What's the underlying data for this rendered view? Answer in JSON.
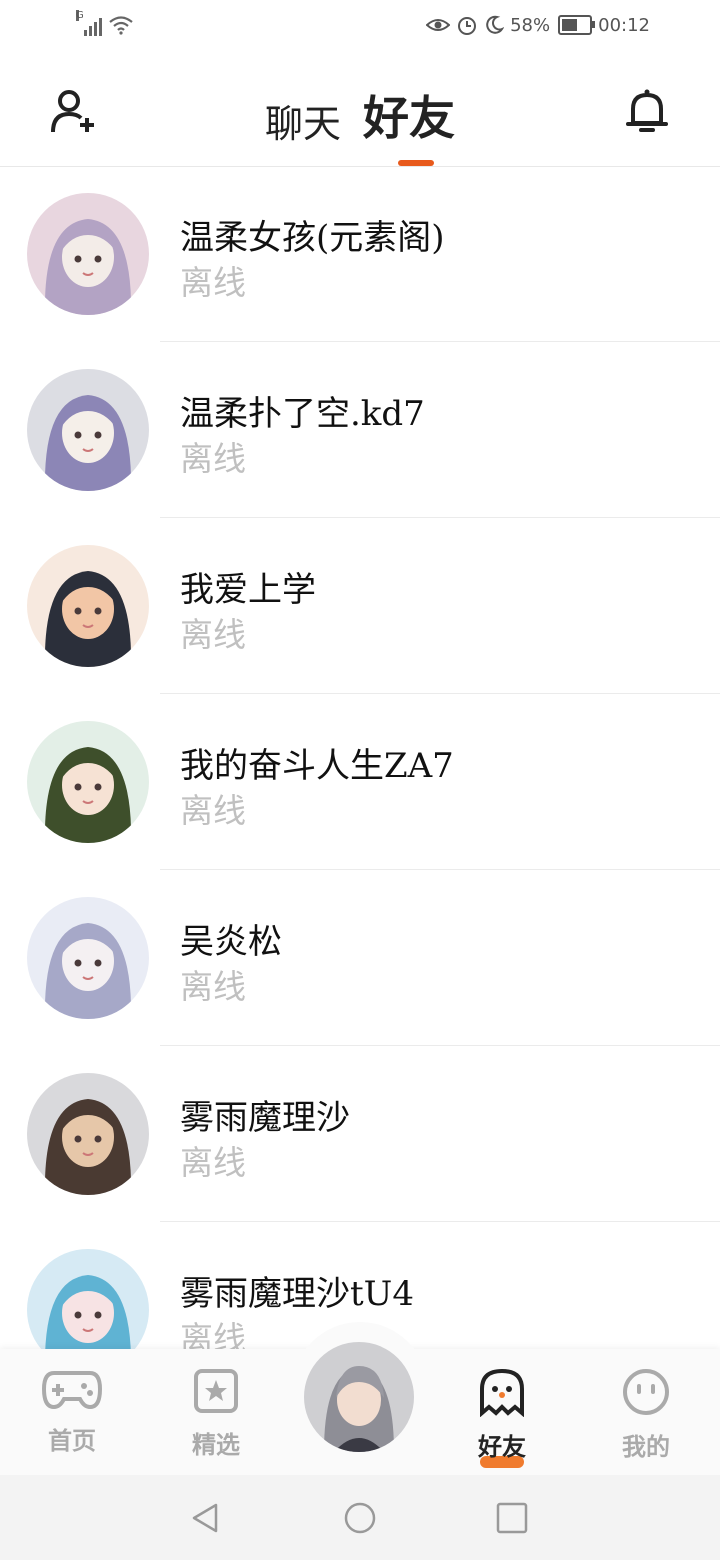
{
  "status_bar": {
    "network_gen": "G",
    "battery_percent": "58%",
    "time": "00:12",
    "battery_level": 0.58
  },
  "header": {
    "tab_chat": "聊天",
    "tab_friends": "好友",
    "active_tab": "好友",
    "accent_color": "#e85a1c"
  },
  "friends": [
    {
      "name": "温柔女孩(元素阁)",
      "status": "离线",
      "avatar_colors": [
        "#e8d6df",
        "#b3a3c4",
        "#f3ece8"
      ]
    },
    {
      "name": "温柔扑了空.kd7",
      "status": "离线",
      "avatar_colors": [
        "#dcdde3",
        "#8c86b6",
        "#f5efe9"
      ]
    },
    {
      "name": "我爱上学",
      "status": "离线",
      "avatar_colors": [
        "#f7e9df",
        "#2b2f3a",
        "#f2c6a6"
      ]
    },
    {
      "name": "我的奋斗人生ZA7",
      "status": "离线",
      "avatar_colors": [
        "#e3efe7",
        "#3e4f2b",
        "#f6e2d4"
      ]
    },
    {
      "name": "吴炎松",
      "status": "离线",
      "avatar_colors": [
        "#e9ecf5",
        "#a6a8c8",
        "#f4f0f2"
      ]
    },
    {
      "name": "雾雨魔理沙",
      "status": "离线",
      "avatar_colors": [
        "#d9d9dc",
        "#4a3a32",
        "#e6c7a9"
      ]
    },
    {
      "name": "雾雨魔理沙tU4",
      "status": "离线",
      "avatar_colors": [
        "#d6eaf4",
        "#5fb3d3",
        "#f7e3e4"
      ]
    }
  ],
  "bottom_nav": {
    "items": [
      {
        "label": "首页",
        "icon": "gamepad-icon"
      },
      {
        "label": "精选",
        "icon": "star-badge-icon"
      },
      {
        "label": "好友",
        "icon": "ghost-icon"
      },
      {
        "label": "我的",
        "icon": "smiley-icon"
      }
    ],
    "active": "好友",
    "active_color": "#f07b2e"
  }
}
